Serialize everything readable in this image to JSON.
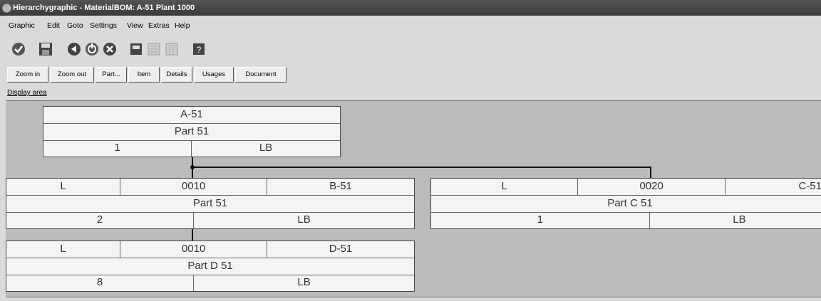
{
  "window": {
    "title": "Hierarchygraphic - MaterialBOM: A-51 Plant 1000"
  },
  "menu": [
    "Graphic",
    "Edit",
    "Goto",
    "Settings",
    "View",
    "Extras",
    "Help"
  ],
  "toolbar_icons": [
    "check-icon",
    "save-icon",
    "back-icon",
    "exit-icon",
    "cancel-icon",
    "print-icon",
    "layout-icon",
    "layout-alt-icon",
    "help-icon"
  ],
  "buttons": [
    "Zoom in",
    "Zoom out",
    "Part...",
    "Item",
    "Details",
    "Usages",
    "Document"
  ],
  "display_area_label": "Display area",
  "nodes": {
    "a51": {
      "material": "A-51",
      "description": "Part 51",
      "quantity": "1",
      "unit": "LB"
    },
    "b51": {
      "item_category": "L",
      "item": "0010",
      "material": "B-51",
      "description": "Part 51",
      "quantity": "2",
      "unit": "LB"
    },
    "c51": {
      "item_category": "L",
      "item": "0020",
      "material": "C-51",
      "description": "Part C 51",
      "quantity": "1",
      "unit": "LB"
    },
    "d51": {
      "item_category": "L",
      "item": "0010",
      "material": "D-51",
      "description": "Part D 51",
      "quantity": "8",
      "unit": "LB"
    }
  }
}
